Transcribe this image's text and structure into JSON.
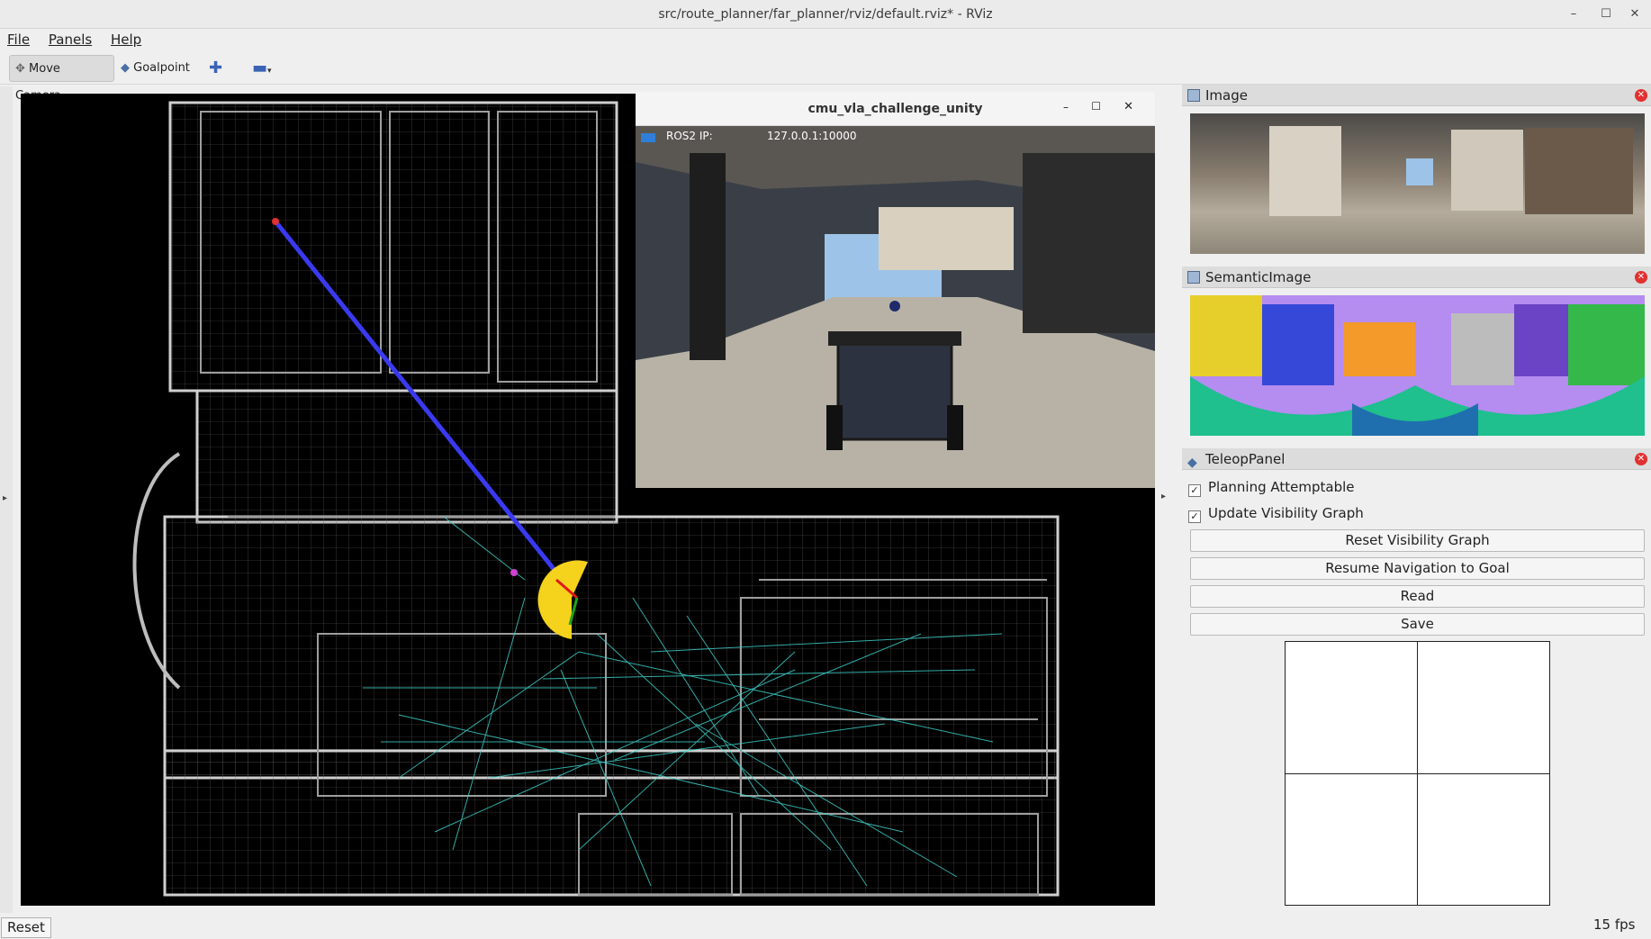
{
  "window": {
    "title": "src/route_planner/far_planner/rviz/default.rviz* - RViz",
    "controls": {
      "minimize": "–",
      "maximize": "☐",
      "close": "✕"
    }
  },
  "menu": {
    "file": "File",
    "panels": "Panels",
    "help": "Help"
  },
  "toolbar": {
    "move_camera": "Move Camera",
    "goalpoint": "Goalpoint",
    "add_icon": "plus-icon",
    "remove_icon": "minus-icon"
  },
  "unity_window": {
    "title": "cmu_vla_challenge_unity",
    "ros_label": "ROS2 IP:",
    "ros_ip": "127.0.0.1:10000"
  },
  "panels": {
    "image": {
      "title": "Image"
    },
    "semantic": {
      "title": "SemanticImage"
    },
    "teleop": {
      "title": "TeleopPanel",
      "checkboxes": [
        {
          "label": "Planning Attemptable",
          "checked": true
        },
        {
          "label": "Update Visibility Graph",
          "checked": true
        }
      ],
      "buttons": [
        "Reset Visibility Graph",
        "Resume Navigation to Goal",
        "Read",
        "Save"
      ]
    }
  },
  "status": {
    "reset": "Reset",
    "fps": "15 fps"
  },
  "colors": {
    "path": "#3a3af0",
    "graph": "#3fd6d0",
    "robot": "#f5d21c",
    "close": "#e23030"
  }
}
